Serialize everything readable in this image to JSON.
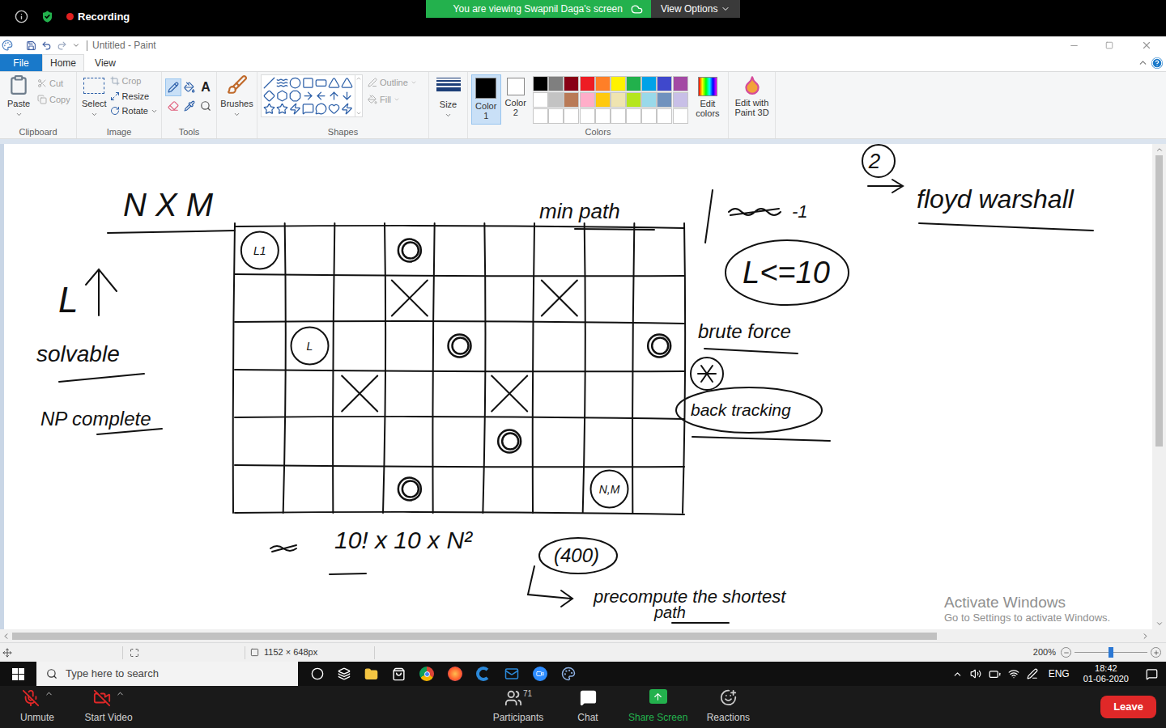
{
  "zoom_top_bar": {
    "recording_label": "Recording",
    "banner": "You are viewing Swapnil Daga's screen",
    "view_options": "View Options"
  },
  "paint_window": {
    "title": "Untitled - Paint"
  },
  "ribbon_tabs": [
    {
      "label": "File",
      "selected": false
    },
    {
      "label": "Home",
      "selected": true
    },
    {
      "label": "View",
      "selected": false
    }
  ],
  "clipboard": {
    "group": "Clipboard",
    "paste": "Paste",
    "cut": "Cut",
    "copy": "Copy",
    "cut_disabled": true,
    "copy_disabled": true
  },
  "image": {
    "group": "Image",
    "select": "Select",
    "crop": "Crop",
    "resize": "Resize",
    "rotate": "Rotate"
  },
  "tools": {
    "group": "Tools",
    "items": [
      {
        "kind": "pencil",
        "selected": true
      },
      {
        "kind": "fill",
        "selected": false
      },
      {
        "kind": "text",
        "label": "A",
        "selected": false
      },
      {
        "kind": "eraser",
        "selected": false
      },
      {
        "kind": "picker",
        "selected": false
      },
      {
        "kind": "magnifier",
        "selected": false
      }
    ]
  },
  "brushes": {
    "label": "Brushes"
  },
  "shapes": {
    "group": "Shapes",
    "outline": "Outline",
    "fill": "Fill",
    "outline_disabled": true,
    "fill_disabled": true
  },
  "size": {
    "label": "Size"
  },
  "colors": {
    "group": "Colors",
    "color1": {
      "label": "Color 1",
      "color": "#000000",
      "selected": true
    },
    "color2": {
      "label": "Color 2",
      "color": "#ffffff",
      "selected": false
    },
    "palette": [
      {
        "color": "#000000"
      },
      {
        "color": "#7f7f7f"
      },
      {
        "color": "#880015"
      },
      {
        "color": "#ed1c24"
      },
      {
        "color": "#ff7f27"
      },
      {
        "color": "#fff200"
      },
      {
        "color": "#22b14c"
      },
      {
        "color": "#00a2e8"
      },
      {
        "color": "#3f48cc"
      },
      {
        "color": "#a349a4"
      },
      {
        "color": "#ffffff"
      },
      {
        "color": "#c3c3c3"
      },
      {
        "color": "#b97a57"
      },
      {
        "color": "#ffaec9"
      },
      {
        "color": "#ffc90e"
      },
      {
        "color": "#efe4b0"
      },
      {
        "color": "#b5e61d"
      },
      {
        "color": "#99d9ea"
      },
      {
        "color": "#7092be"
      },
      {
        "color": "#c8bfe7"
      },
      {
        "color": "#ffffff"
      },
      {
        "color": "#ffffff"
      },
      {
        "color": "#ffffff"
      },
      {
        "color": "#ffffff"
      },
      {
        "color": "#ffffff"
      },
      {
        "color": "#ffffff"
      },
      {
        "color": "#ffffff"
      },
      {
        "color": "#ffffff"
      },
      {
        "color": "#ffffff"
      },
      {
        "color": "#ffffff"
      }
    ],
    "edit_colors": "Edit colors"
  },
  "paint3d": {
    "label": "Edit with Paint 3D"
  },
  "drawing": {
    "annotations": [
      "N X M",
      "min path",
      "-1",
      "L<=10",
      "brute force",
      "back tracking",
      "L",
      "solvable",
      "NP complete",
      "2",
      "floyd warshall",
      "10! x 10 x N²",
      "(400)",
      "precompute the shortest",
      "path"
    ],
    "grid": {
      "rows": [
        [
          {
            "kind": "label",
            "text": "L1"
          },
          {
            "kind": "empty"
          },
          {
            "kind": "empty"
          },
          {
            "kind": "circle"
          },
          {
            "kind": "empty"
          },
          {
            "kind": "empty"
          },
          {
            "kind": "empty"
          },
          {
            "kind": "empty"
          },
          {
            "kind": "empty"
          }
        ],
        [
          {
            "kind": "empty"
          },
          {
            "kind": "empty"
          },
          {
            "kind": "empty"
          },
          {
            "kind": "cross"
          },
          {
            "kind": "empty"
          },
          {
            "kind": "empty"
          },
          {
            "kind": "cross"
          },
          {
            "kind": "empty"
          },
          {
            "kind": "empty"
          }
        ],
        [
          {
            "kind": "empty"
          },
          {
            "kind": "label",
            "text": "L"
          },
          {
            "kind": "empty"
          },
          {
            "kind": "empty"
          },
          {
            "kind": "circle"
          },
          {
            "kind": "empty"
          },
          {
            "kind": "empty"
          },
          {
            "kind": "empty"
          },
          {
            "kind": "circle"
          }
        ],
        [
          {
            "kind": "empty"
          },
          {
            "kind": "empty"
          },
          {
            "kind": "cross"
          },
          {
            "kind": "empty"
          },
          {
            "kind": "empty"
          },
          {
            "kind": "cross"
          },
          {
            "kind": "empty"
          },
          {
            "kind": "empty"
          },
          {
            "kind": "empty"
          }
        ],
        [
          {
            "kind": "empty"
          },
          {
            "kind": "empty"
          },
          {
            "kind": "empty"
          },
          {
            "kind": "empty"
          },
          {
            "kind": "empty"
          },
          {
            "kind": "circle"
          },
          {
            "kind": "empty"
          },
          {
            "kind": "empty"
          },
          {
            "kind": "empty"
          }
        ],
        [
          {
            "kind": "empty"
          },
          {
            "kind": "empty"
          },
          {
            "kind": "empty"
          },
          {
            "kind": "circle"
          },
          {
            "kind": "empty"
          },
          {
            "kind": "empty"
          },
          {
            "kind": "empty"
          },
          {
            "kind": "label",
            "text": "N,M"
          },
          {
            "kind": "empty"
          }
        ]
      ]
    }
  },
  "watermark": {
    "title": "Activate Windows",
    "subtitle": "Go to Settings to activate Windows."
  },
  "status_bar": {
    "canvas_size": "1152 × 648px",
    "zoom": "200%",
    "zoom_level": 0.5
  },
  "taskbar": {
    "search_placeholder": "Type here to search",
    "language": "ENG",
    "time": "18:42",
    "date": "01-06-2020"
  },
  "zoom_bottom_bar": {
    "buttons": [
      {
        "label": "Unmute",
        "kind": "mic",
        "muted": true
      },
      {
        "label": "Start Video",
        "kind": "video",
        "muted": true
      },
      {
        "label": "Participants",
        "kind": "participants",
        "count": "71"
      },
      {
        "label": "Chat",
        "kind": "chat"
      },
      {
        "label": "Share Screen",
        "kind": "share"
      },
      {
        "label": "Reactions",
        "kind": "reactions"
      }
    ],
    "leave": "Leave"
  }
}
